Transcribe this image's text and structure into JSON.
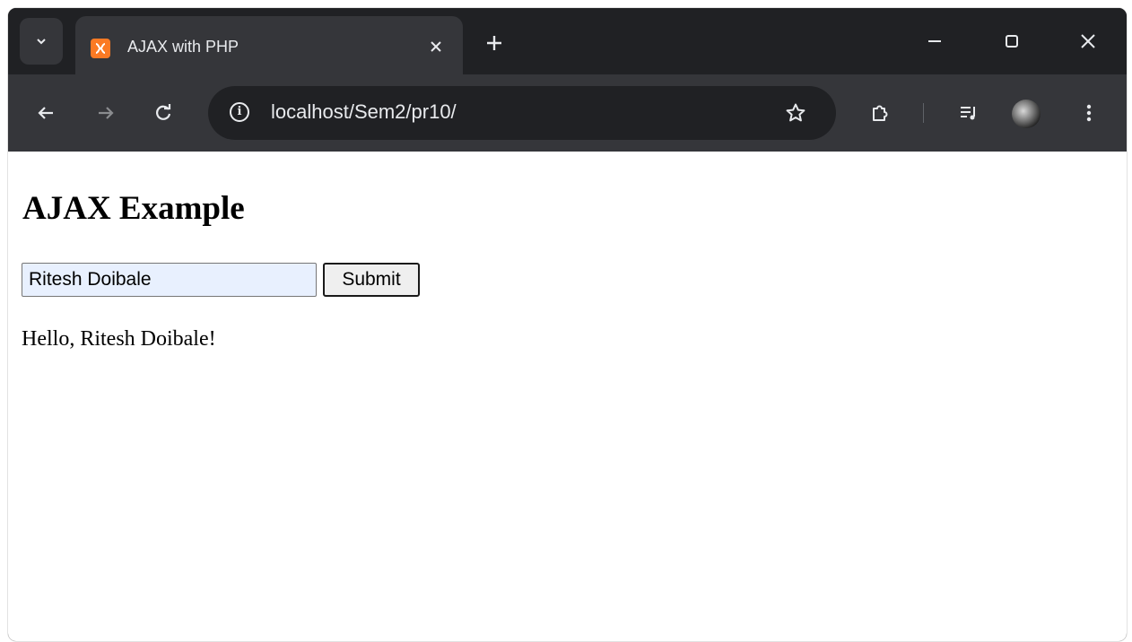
{
  "browser": {
    "tab": {
      "title": "AJAX with PHP",
      "favicon": "xampp-icon"
    },
    "address_bar": {
      "url": "localhost/Sem2/pr10/"
    },
    "colors": {
      "frame": "#202124",
      "toolbar": "#35363a",
      "favicon": "#fb7a24"
    }
  },
  "page": {
    "heading": "AJAX Example",
    "name_input": {
      "value": "Ritesh Doibale"
    },
    "submit_label": "Submit",
    "result_text": "Hello, Ritesh Doibale!"
  }
}
